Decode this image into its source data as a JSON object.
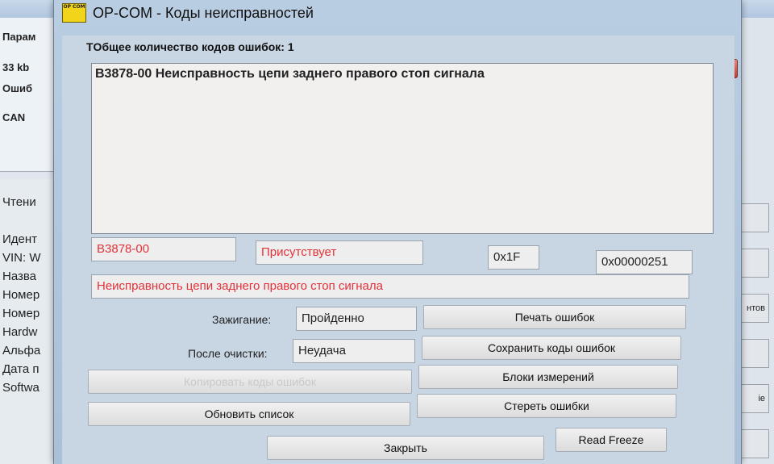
{
  "background_window": {
    "fragments_top": [
      "Парам",
      "33 kb",
      "Ошиб",
      "CAN"
    ],
    "fragments_bottom": [
      "Чтени",
      "Идент",
      "VIN: W",
      "Назва",
      "Номер",
      "Номер",
      "Hardw",
      "Альфа",
      "Дата п",
      "Softwa"
    ],
    "right_buttons": [
      "нтов",
      "ie"
    ]
  },
  "dialog": {
    "icon_text": "OP COM",
    "title": "OP-COM - Коды неисправностей",
    "close_glyph": "x",
    "count_label": "TОбщее количество кодов ошибок: 1",
    "code_list": [
      "B3878-00 Неисправность цепи заднего правого стоп сигнала"
    ],
    "detail": {
      "code": "B3878-00",
      "status": "Присутствует",
      "hex1": "0x1F",
      "hex2": "0x00000251",
      "description": "Неисправность цепи заднего правого стоп сигнала"
    },
    "ignition_label": "Зажигание:",
    "ignition_value": "Пройденно",
    "after_clear_label": "После очистки:",
    "after_clear_value": "Неудача",
    "buttons": {
      "print": "Печать ошибок",
      "save": "Сохранить коды ошибок",
      "blocks": "Блоки измерений",
      "copy": "Копировать коды ошибок",
      "clear": "Стереть ошибки",
      "refresh": "Обновить список",
      "close": "Закрыть",
      "freeze": "Read Freeze"
    }
  }
}
